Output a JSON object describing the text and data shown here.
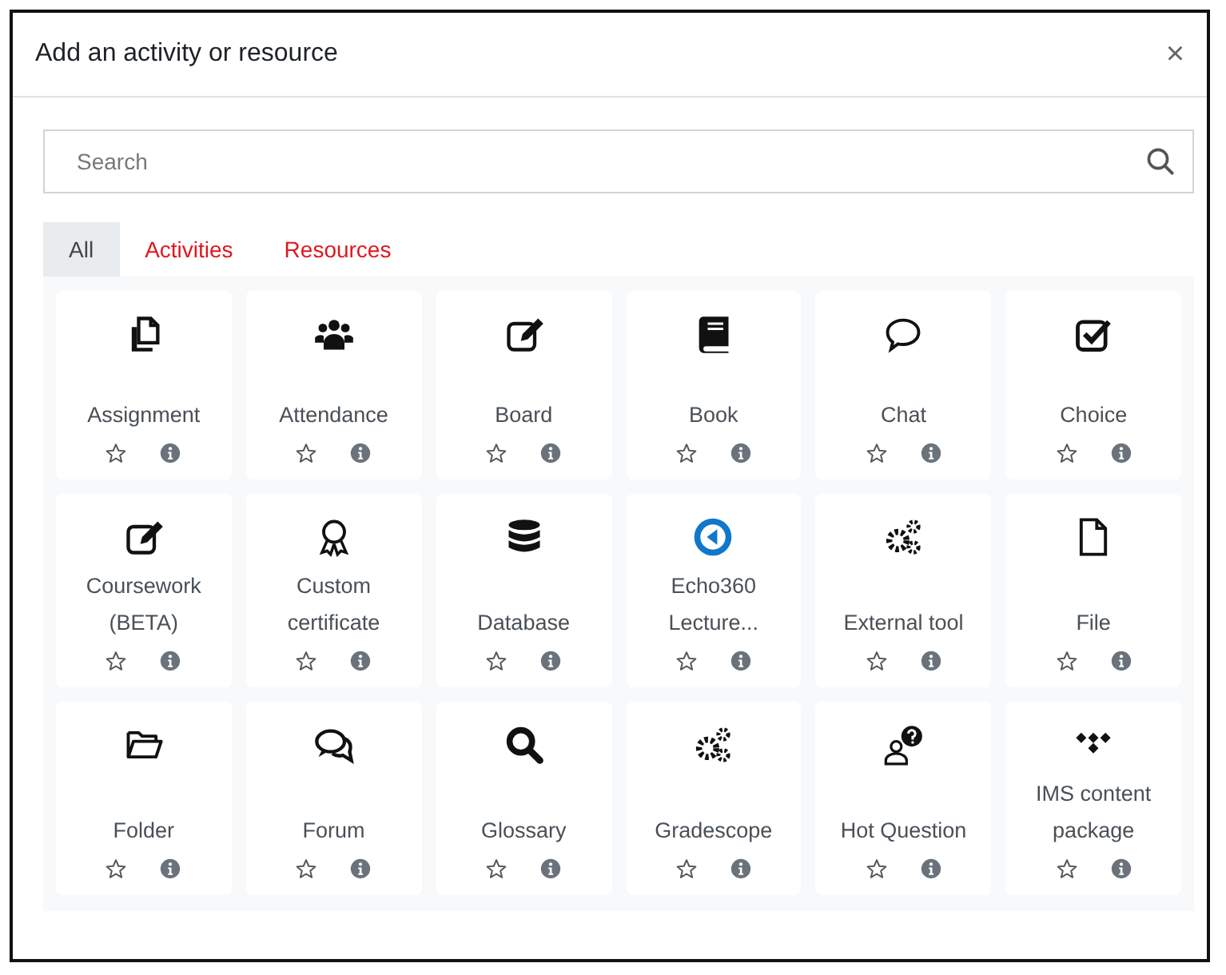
{
  "dialog": {
    "title": "Add an activity or resource",
    "close": "×"
  },
  "search": {
    "placeholder": "Search"
  },
  "tabs": [
    {
      "label": "All",
      "selected": true
    },
    {
      "label": "Activities",
      "selected": false
    },
    {
      "label": "Resources",
      "selected": false
    }
  ],
  "items": [
    {
      "label": "Assignment",
      "starred": false
    },
    {
      "label": "Attendance",
      "starred": false
    },
    {
      "label": "Board",
      "starred": false
    },
    {
      "label": "Book",
      "starred": false
    },
    {
      "label": "Chat",
      "starred": false
    },
    {
      "label": "Choice",
      "starred": false
    },
    {
      "label": "Coursework (BETA)",
      "starred": false
    },
    {
      "label": "Custom certificate",
      "starred": false
    },
    {
      "label": "Database",
      "starred": false
    },
    {
      "label": "Echo360 Lecture...",
      "starred": false
    },
    {
      "label": "External tool",
      "starred": false
    },
    {
      "label": "File",
      "starred": false
    },
    {
      "label": "Folder",
      "starred": false
    },
    {
      "label": "Forum",
      "starred": false
    },
    {
      "label": "Glossary",
      "starred": false
    },
    {
      "label": "Gradescope",
      "starred": false
    },
    {
      "label": "Hot Question",
      "starred": false
    },
    {
      "label": "IMS content package",
      "starred": false
    }
  ]
}
